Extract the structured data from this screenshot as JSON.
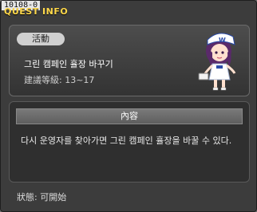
{
  "window": {
    "id_label": "10108-0",
    "title": "QUEST INFO"
  },
  "quest": {
    "category_badge": "活動",
    "name": "그린 캠페인 휼장 바꾸기",
    "level_range": "建議等級: 13~17"
  },
  "content": {
    "header": "內容",
    "description": "다시 운영자를 찾아가면 그린 캠페인 휼장을 바꿀 수 있다."
  },
  "footer": {
    "status": "狀態: 可開始"
  },
  "colors": {
    "title": "#ffd84a",
    "window_bg": "#3c3c3c",
    "badge_bg": "#d0d0d0"
  },
  "npc_icon": "nurse-npc-icon"
}
